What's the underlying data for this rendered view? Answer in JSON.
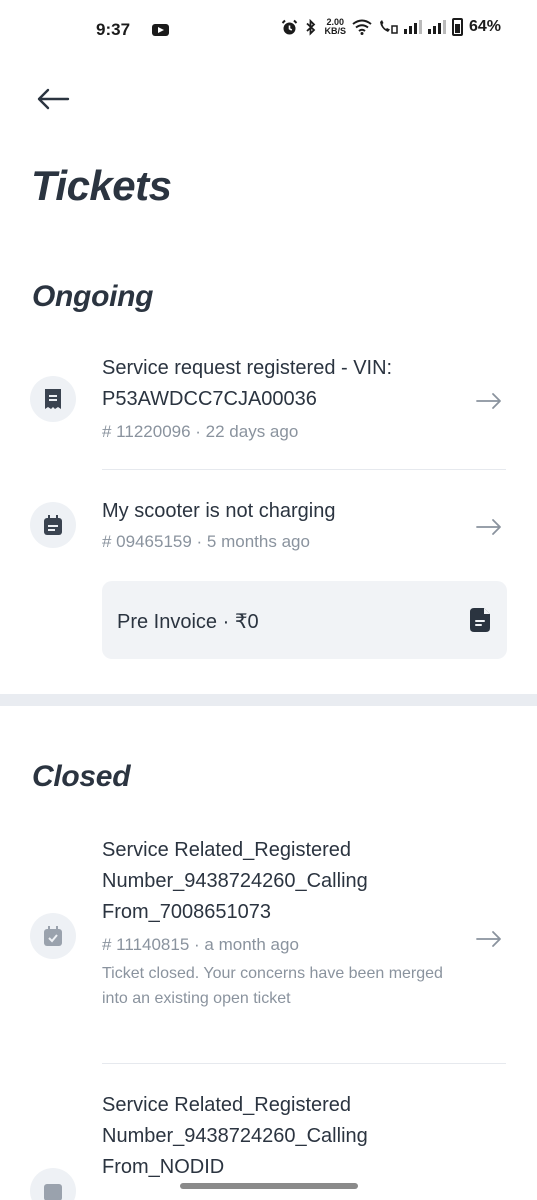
{
  "status_bar": {
    "time": "9:37",
    "net_speed_value": "2.00",
    "net_speed_unit": "KB/S",
    "battery": "64%"
  },
  "header": {
    "title": "Tickets"
  },
  "ongoing": {
    "heading": "Ongoing",
    "tickets": [
      {
        "title": "Service request registered - VIN: P53AWDCC7CJA00036",
        "meta": "# 11220096 · 22 days ago",
        "icon": "receipt-icon"
      },
      {
        "title": "My scooter is not charging",
        "meta": "# 09465159 · 5 months ago",
        "icon": "calendar-icon"
      }
    ],
    "invoice": {
      "label": "Pre Invoice · ₹0",
      "icon": "document-icon"
    }
  },
  "closed": {
    "heading": "Closed",
    "tickets": [
      {
        "title": "Service Related_Registered Number_9438724260_Calling From_7008651073",
        "meta": "# 11140815 · a month ago",
        "note": "Ticket closed. Your concerns have been merged into an existing open ticket",
        "icon": "calendar-check-icon"
      },
      {
        "title": "Service Related_Registered Number_9438724260_Calling From_NODID",
        "icon": "calendar-check-icon"
      }
    ]
  },
  "colors": {
    "text_primary": "#2b3440",
    "text_secondary": "#8a939e",
    "icon_bg": "#eef1f5",
    "card_bg": "#f1f3f6"
  }
}
